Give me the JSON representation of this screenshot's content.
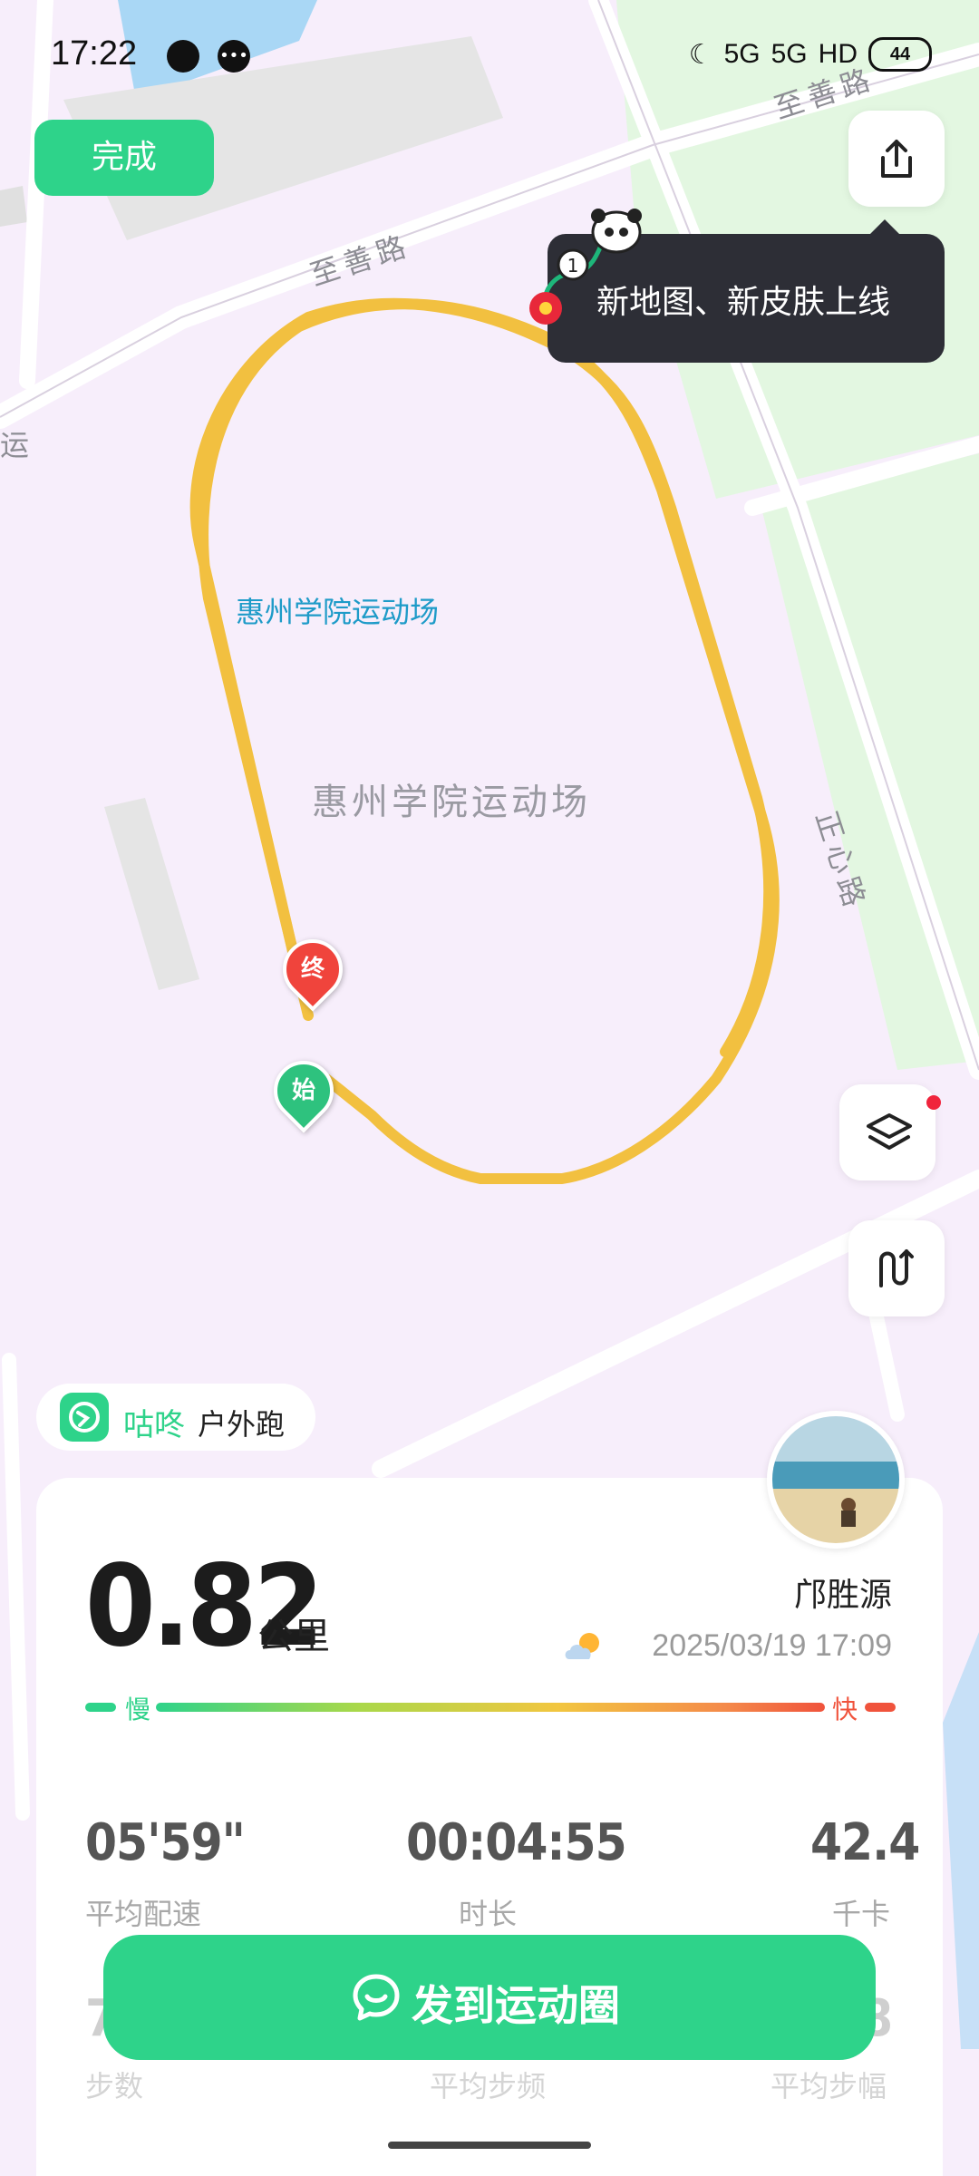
{
  "status_bar": {
    "time": "17:22",
    "network_label": "5G",
    "hd_label": "HD",
    "battery": "44"
  },
  "top_actions": {
    "done_label": "完成",
    "share_icon": "share-icon"
  },
  "tooltip": {
    "text": "新地图、新皮肤上线"
  },
  "map": {
    "roads": {
      "zhishan_upper": "至善路",
      "zhishan_mid": "至善路",
      "zhengxin": "正心路",
      "partial_left": "运"
    },
    "place_label_blue": "惠州学院运动场",
    "place_label_grey": "惠州学院运动场",
    "pin_end": "终",
    "pin_start": "始",
    "route_color": "#f2c040"
  },
  "app_chip": {
    "brand": "咕咚",
    "mode": "户外跑"
  },
  "summary": {
    "distance": "0.82",
    "distance_unit": "公里",
    "user_name": "邝胜源",
    "datetime": "2025/03/19 17:09",
    "weather_icon": "partly-cloudy-icon",
    "pace_slow": "慢",
    "pace_fast": "快"
  },
  "stats": [
    {
      "value": "05'59\"",
      "label": "平均配速"
    },
    {
      "value": "00:04:55",
      "label": "时长"
    },
    {
      "value": "42.4",
      "label": "千卡"
    }
  ],
  "stats_row2": [
    {
      "value": "7",
      "label": "步数"
    },
    {
      "value": "",
      "label": "平均步频"
    },
    {
      "value": "8",
      "label": "平均步幅"
    }
  ],
  "share_button": {
    "label": "发到运动圈"
  },
  "colors": {
    "accent": "#2ed38a",
    "fast": "#f0533c",
    "map_bg": "#f7eefb",
    "park": "#e3f7e1"
  }
}
